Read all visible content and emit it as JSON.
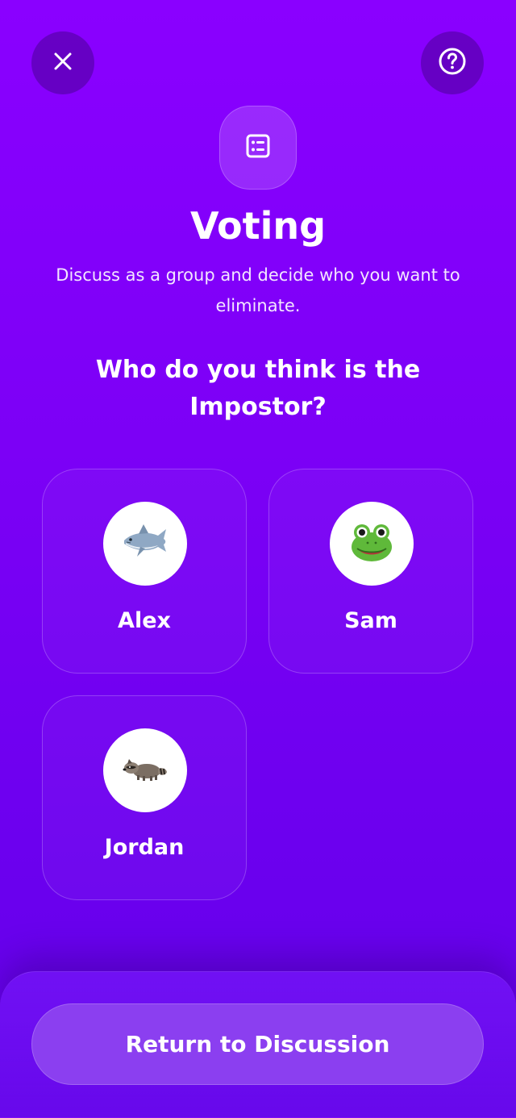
{
  "header": {
    "close_icon": "close-icon",
    "help_icon": "help-circle-icon",
    "screen_icon": "ballot-list-icon"
  },
  "voting": {
    "title": "Voting",
    "subtitle": "Discuss as a group and decide who you want to eliminate.",
    "question": "Who do you think is the Impostor?"
  },
  "players": [
    {
      "name": "Alex",
      "avatar": "🦈",
      "avatar_icon": "shark-icon"
    },
    {
      "name": "Sam",
      "avatar": "🐸",
      "avatar_icon": "frog-icon"
    },
    {
      "name": "Jordan",
      "avatar": "🦝",
      "avatar_icon": "raccoon-icon"
    }
  ],
  "footer": {
    "return_label": "Return to Discussion"
  },
  "colors": {
    "background_top": "#8a00ff",
    "background_bottom": "#6300e8",
    "button": "#8b3ff0"
  }
}
